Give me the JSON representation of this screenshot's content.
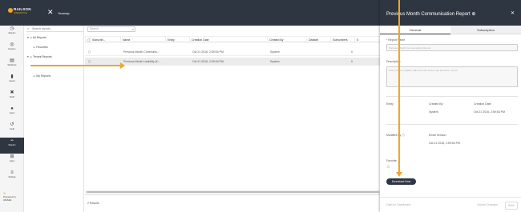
{
  "app": {
    "logo_text": "RAILSON",
    "logo_sub": "INTERACTIVE",
    "title": "Yearnap"
  },
  "leftnav": {
    "items": [
      {
        "label": "Reports",
        "icon": "clock-icon"
      },
      {
        "label": "Devices",
        "icon": "target-icon"
      },
      {
        "label": "WorkLists",
        "icon": "document-icon"
      },
      {
        "label": "Assets",
        "icon": "stamp-icon"
      },
      {
        "label": "Build",
        "icon": "tools-icon"
      },
      {
        "label": "Users",
        "icon": "user-icon"
      },
      {
        "label": "Audit",
        "icon": "history-icon"
      },
      {
        "label": "Reports",
        "icon": "reports-icon",
        "active": true
      },
      {
        "label": "Apps",
        "icon": "grid-icon"
      },
      {
        "label": "Settings",
        "icon": "sliders-icon"
      }
    ],
    "bottom_line1": "≋",
    "bottom_line2": "Powered by",
    "bottom_line3": "AMAZE"
  },
  "tree": {
    "search_placeholder": "Search reports",
    "items": [
      {
        "label": "All Reports",
        "indent": 0,
        "caret": "▾"
      },
      {
        "label": "Favorites",
        "indent": 1,
        "caret": ""
      },
      {
        "label": "Tenant Reports",
        "indent": 0,
        "caret": "▾"
      },
      {
        "label": "My Reports",
        "indent": 1,
        "caret": ""
      }
    ]
  },
  "grid": {
    "search_placeholder": "Search",
    "columns": [
      "Subscrib...",
      "Name",
      "Entity",
      "Creation Date",
      "Created By",
      "Dataset",
      "Subscribers",
      "S"
    ],
    "rows": [
      {
        "name": "Previous Month Communic...",
        "entity": "",
        "date": "Oct 21 2016, 2:59:53 PM",
        "created_by": "System",
        "dataset": "",
        "subscribers": "0"
      },
      {
        "name": "Previous Month Usability (K...",
        "entity": "",
        "date": "Oct 21 2016, 2:59:54 PM",
        "created_by": "System",
        "dataset": "",
        "subscribers": "0"
      }
    ],
    "footer": "2 Results"
  },
  "panel": {
    "title": "Previous Month Communication Report",
    "title_icon": "⊕",
    "close": "✕",
    "tabs": {
      "general": "General",
      "subscription": "Subscription"
    },
    "name_label": "Report Name",
    "name_value": "Previous Month Communication Report",
    "description_label": "Description",
    "description_value": "Total number of SMS, calls over last and on-tap presence month",
    "entity_label": "Entity",
    "created_by_label": "Created By",
    "created_by_value": "System",
    "creation_date_label": "Creation Date",
    "creation_date_value": "Oct 21 2016, 2:59:53 PM",
    "modified_label": "Modified By",
    "modified_value": "Email Version",
    "modified_date": "Oct 21 2016, 2:59:53 PM",
    "favorite_label": "Favorite",
    "download_label": "Download Now",
    "open_dashboard": "Open in Dashboard",
    "cancel_changes": "Cancel Changes",
    "save": "Save"
  },
  "colors": {
    "header": "#2e3642",
    "accent": "#f0a52d"
  }
}
